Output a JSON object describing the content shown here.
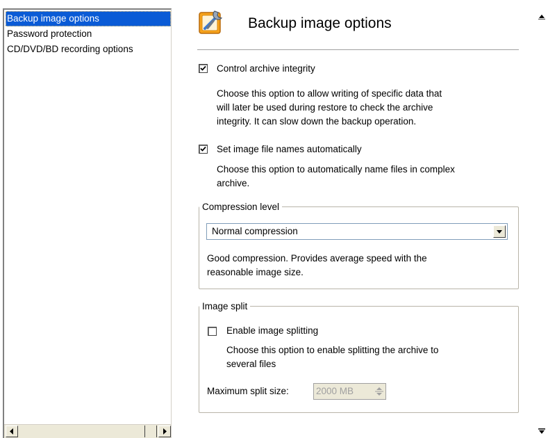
{
  "sidebar": {
    "items": [
      {
        "label": "Backup image options",
        "selected": true
      },
      {
        "label": "Password protection",
        "selected": false
      },
      {
        "label": "CD/DVD/BD recording options",
        "selected": false
      }
    ]
  },
  "header": {
    "title": "Backup image options",
    "icon": "settings-wrench-icon"
  },
  "options": {
    "control_integrity": {
      "label": "Control archive integrity",
      "checked": true,
      "desc_lines": [
        "Choose this option to allow writing of specific data that",
        "will later be used during restore to check the archive",
        "integrity. It can slow down the backup operation."
      ]
    },
    "auto_names": {
      "label": "Set image file names automatically",
      "checked": true,
      "desc_lines": [
        "Choose this option to automatically name files in complex",
        "archive."
      ]
    }
  },
  "compression": {
    "legend": "Compression level",
    "selected": "Normal compression",
    "desc_lines": [
      "Good compression. Provides average speed with the",
      "reasonable image size."
    ]
  },
  "split": {
    "legend": "Image split",
    "enable_label": "Enable image splitting",
    "enabled": false,
    "desc_lines": [
      "Choose this option to enable splitting the archive to",
      "several files"
    ],
    "max_label": "Maximum split size:",
    "max_value": "2000 MB"
  },
  "colors": {
    "selection": "#0a5bd6",
    "disabled_text": "#a0a0a0"
  }
}
